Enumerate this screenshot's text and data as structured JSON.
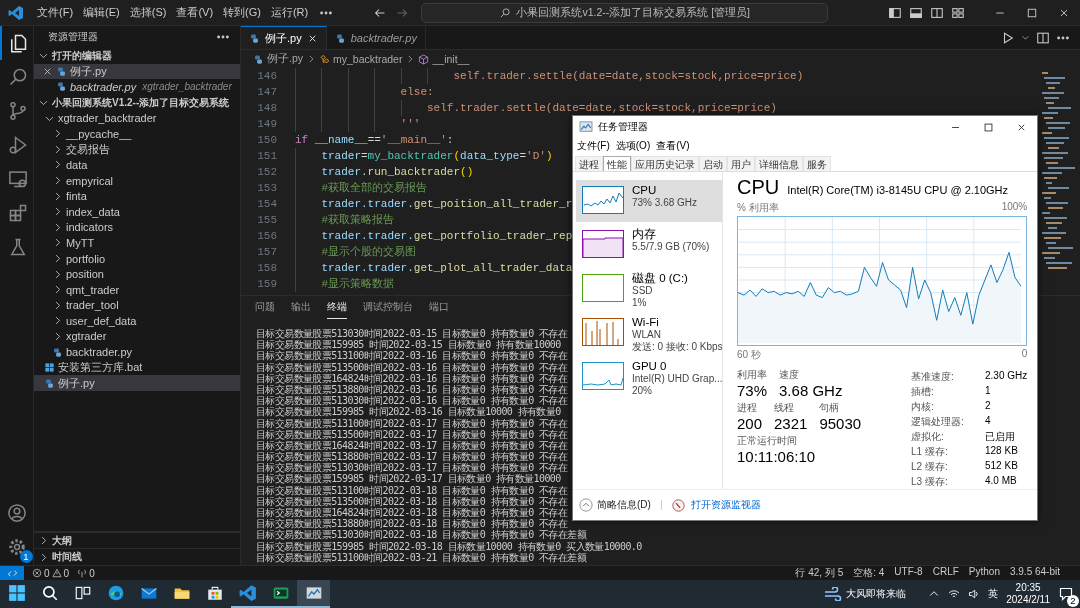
{
  "title_bar": {
    "menus": [
      "文件(F)",
      "编辑(E)",
      "选择(S)",
      "查看(V)",
      "转到(G)",
      "运行(R)"
    ],
    "command_center": "小果回测系统v1.2--添加了目标交易系统 [管理员]"
  },
  "activity_bar": {
    "items": [
      {
        "kind": "explorer",
        "selected": true
      },
      {
        "kind": "search",
        "selected": false
      },
      {
        "kind": "source-control",
        "selected": false
      },
      {
        "kind": "run",
        "selected": false
      },
      {
        "kind": "remote",
        "selected": false
      },
      {
        "kind": "extensions",
        "selected": false
      },
      {
        "kind": "testing",
        "selected": false
      }
    ],
    "settings_badge": "1"
  },
  "sidebar": {
    "title": "资源管理器",
    "open_editors": {
      "label": "打开的编辑器",
      "expanded": true,
      "items": [
        {
          "name": "例子.py",
          "selected": true,
          "italic": false
        },
        {
          "name": "backtrader.py",
          "detail": "xgtrader_backtrader",
          "selected": false,
          "italic": true
        }
      ]
    },
    "project": {
      "label": "小果回测系统V1.2--添加了目标交易系统",
      "expanded": true,
      "tree": [
        {
          "name": "xgtrader_backtrader",
          "kind": "folder",
          "expanded": true,
          "selected": false,
          "children": [
            {
              "name": "__pycache__",
              "kind": "folder",
              "expanded": false,
              "selected": false
            },
            {
              "name": "交易报告",
              "kind": "folder",
              "expanded": false,
              "selected": false
            },
            {
              "name": "data",
              "kind": "folder",
              "expanded": false,
              "selected": false
            },
            {
              "name": "empyrical",
              "kind": "folder",
              "expanded": false,
              "selected": false
            },
            {
              "name": "finta",
              "kind": "folder",
              "expanded": false,
              "selected": false
            },
            {
              "name": "index_data",
              "kind": "folder",
              "expanded": false,
              "selected": false
            },
            {
              "name": "indicators",
              "kind": "folder",
              "expanded": false,
              "selected": false
            },
            {
              "name": "MyTT",
              "kind": "folder",
              "expanded": false,
              "selected": false
            },
            {
              "name": "portfolio",
              "kind": "folder",
              "expanded": false,
              "selected": false
            },
            {
              "name": "position",
              "kind": "folder",
              "expanded": false,
              "selected": false
            },
            {
              "name": "qmt_trader",
              "kind": "folder",
              "expanded": false,
              "selected": false
            },
            {
              "name": "trader_tool",
              "kind": "folder",
              "expanded": false,
              "selected": false
            },
            {
              "name": "user_def_data",
              "kind": "folder",
              "expanded": false,
              "selected": false
            },
            {
              "name": "xgtrader",
              "kind": "folder",
              "expanded": false,
              "selected": false
            },
            {
              "name": "backtrader.py",
              "kind": "py",
              "selected": false
            }
          ]
        },
        {
          "name": "安装第三方库.bat",
          "kind": "bat",
          "selected": false
        },
        {
          "name": "例子.py",
          "kind": "py",
          "selected": true
        }
      ]
    },
    "bottom_sections": [
      {
        "label": "大纲",
        "expanded": false
      },
      {
        "label": "时间线",
        "expanded": false
      }
    ]
  },
  "editor": {
    "tabs": [
      {
        "label": "例子.py",
        "selected": true,
        "italic": false
      },
      {
        "label": "backtrader.py",
        "selected": false,
        "italic": true
      }
    ],
    "breadcrumb": [
      {
        "label": "例子.py",
        "kind": "file"
      },
      {
        "label": "my_backtrader",
        "kind": "class"
      },
      {
        "label": "__init__",
        "kind": "method"
      }
    ],
    "lines": [
      {
        "number": "146",
        "tokens": [
          {
            "text": "                        self.trader.settle(date=date,stock=stock,price=price)",
            "kind": "str"
          }
        ]
      },
      {
        "number": "147",
        "tokens": [
          {
            "text": "                else:",
            "kind": "str"
          }
        ]
      },
      {
        "number": "148",
        "tokens": [
          {
            "text": "                    self.trader.settle(date=date,stock=stock,price=price)",
            "kind": "str"
          }
        ]
      },
      {
        "number": "149",
        "tokens": [
          {
            "text": "                '''",
            "kind": "str"
          }
        ]
      },
      {
        "number": "150",
        "tokens": [
          {
            "text": "if",
            "kind": "kw"
          },
          {
            "text": " __name__",
            "kind": "var"
          },
          {
            "text": "==",
            "kind": "op"
          },
          {
            "text": "'__main__'",
            "kind": "str"
          },
          {
            "text": ":",
            "kind": "op"
          }
        ]
      },
      {
        "number": "151",
        "tokens": [
          {
            "text": "    trader",
            "kind": "var"
          },
          {
            "text": "=",
            "kind": "op"
          },
          {
            "text": "my_backtrader",
            "kind": "cls"
          },
          {
            "text": "(",
            "kind": "br"
          },
          {
            "text": "data_type",
            "kind": "var"
          },
          {
            "text": "=",
            "kind": "op"
          },
          {
            "text": "'D'",
            "kind": "str"
          },
          {
            "text": ")",
            "kind": "br"
          }
        ]
      },
      {
        "number": "152",
        "tokens": [
          {
            "text": "    trader",
            "kind": "var"
          },
          {
            "text": ".",
            "kind": "op"
          },
          {
            "text": "run_backtrader",
            "kind": "fn"
          },
          {
            "text": "()",
            "kind": "br"
          }
        ]
      },
      {
        "number": "153",
        "tokens": [
          {
            "text": "    #获取全部的交易报告",
            "kind": "cm"
          }
        ]
      },
      {
        "number": "154",
        "tokens": [
          {
            "text": "    trader.trader.",
            "kind": "var"
          },
          {
            "text": "get_poition_all_trader_r",
            "kind": "fn"
          }
        ]
      },
      {
        "number": "155",
        "tokens": [
          {
            "text": "    #获取策略报告",
            "kind": "cm"
          }
        ]
      },
      {
        "number": "156",
        "tokens": [
          {
            "text": "    trader.trader.",
            "kind": "var"
          },
          {
            "text": "get_portfolio_trader_rep",
            "kind": "fn"
          }
        ]
      },
      {
        "number": "157",
        "tokens": [
          {
            "text": "    #显示个股的交易图",
            "kind": "cm"
          }
        ]
      },
      {
        "number": "158",
        "tokens": [
          {
            "text": "    trader.trader.",
            "kind": "var"
          },
          {
            "text": "get_plot_all_trader_data",
            "kind": "fn"
          }
        ]
      },
      {
        "number": "159",
        "tokens": [
          {
            "text": "    #显示策略数据",
            "kind": "cm"
          }
        ]
      }
    ]
  },
  "panel": {
    "tabs": [
      {
        "label": "问题",
        "selected": false
      },
      {
        "label": "输出",
        "selected": false
      },
      {
        "label": "终端",
        "selected": true
      },
      {
        "label": "调试控制台",
        "selected": false
      },
      {
        "label": "端口",
        "selected": false
      }
    ],
    "lines": [
      "目标交易数量股票513030时间2022-03-15 目标数量0 持有数量0 不存在",
      "目标交易数量股票159985 时间2022-03-15 目标数量0 持有数量10000",
      "目标交易数量股票513100时间2022-03-16 目标数量0 持有数量0 不存在",
      "目标交易数量股票513500时间2022-03-16 目标数量0 持有数量0 不存在",
      "目标交易数量股票164824时间2022-03-16 目标数量0 持有数量0 不存在",
      "目标交易数量股票513880时间2022-03-16 目标数量0 持有数量0 不存在",
      "目标交易数量股票513030时间2022-03-16 目标数量0 持有数量0 不存在",
      "目标交易数量股票159985 时间2022-03-16 目标数量10000 持有数量0",
      "目标交易数量股票513100时间2022-03-17 目标数量0 持有数量0 不存在",
      "目标交易数量股票513500时间2022-03-17 目标数量0 持有数量0 不存在",
      "目标交易数量股票164824时间2022-03-17 目标数量0 持有数量0 不存在",
      "目标交易数量股票513880时间2022-03-17 目标数量0 持有数量0 不存在",
      "目标交易数量股票513030时间2022-03-17 目标数量0 持有数量0 不存在",
      "目标交易数量股票159985 时间2022-03-17 目标数量0 持有数量10000",
      "目标交易数量股票513100时间2022-03-18 目标数量0 持有数量0 不存在",
      "目标交易数量股票513500时间2022-03-18 目标数量0 持有数量0 不存在",
      "目标交易数量股票164824时间2022-03-18 目标数量0 持有数量0 不存在",
      "目标交易数量股票513880时间2022-03-18 目标数量0 持有数量0 不存在",
      "目标交易数量股票513030时间2022-03-18 目标数量0 持有数量0 不存在差额",
      "目标交易数量股票159985 时间2022-03-18 目标数量10000 持有数量0 买入数量10000.0",
      "目标交易数量股票513100时间2022-03-21 目标数量0 持有数量0 不存在差额"
    ]
  },
  "status_bar": {
    "errors": "0",
    "warnings": "0",
    "ports": "0",
    "right": [
      "行 42, 列 5",
      "空格: 4",
      "UTF-8",
      "CRLF",
      "Python",
      "3.9.5 64-bit"
    ]
  },
  "task_manager": {
    "title": "任务管理器",
    "menus": [
      "文件(F)",
      "选项(O)",
      "查看(V)"
    ],
    "tabs": [
      {
        "label": "进程",
        "selected": false
      },
      {
        "label": "性能",
        "selected": true
      },
      {
        "label": "应用历史记录",
        "selected": false
      },
      {
        "label": "启动",
        "selected": false
      },
      {
        "label": "用户",
        "selected": false
      },
      {
        "label": "详细信息",
        "selected": false
      },
      {
        "label": "服务",
        "selected": false
      }
    ],
    "resources": [
      {
        "kind": "cpu",
        "name": "CPU",
        "lines": [
          "73% 3.68 GHz"
        ],
        "selected": true,
        "color": "#117dbb"
      },
      {
        "kind": "memory",
        "name": "内存",
        "lines": [
          "5.5/7.9 GB (70%)"
        ],
        "selected": false,
        "color": "#8b12ae"
      },
      {
        "kind": "disk",
        "name": "磁盘 0 (C:)",
        "lines": [
          "SSD",
          "1%"
        ],
        "selected": false,
        "color": "#4da60c"
      },
      {
        "kind": "network",
        "name": "Wi-Fi",
        "lines": [
          "WLAN",
          "发送: 0 接收: 0 Kbps"
        ],
        "selected": false,
        "color": "#a74f01"
      },
      {
        "kind": "gpu",
        "name": "GPU 0",
        "lines": [
          "Intel(R) UHD Grap...",
          "20%"
        ],
        "selected": false,
        "color": "#1e90c8"
      }
    ],
    "detail": {
      "title": "CPU",
      "model": "Intel(R) Core(TM) i3-8145U CPU @ 2.10GHz",
      "graph_label": "% 利用率",
      "graph_max": "100%",
      "time_start": "60 秒",
      "time_end": "0",
      "stats": [
        {
          "label": "利用率",
          "value": "73%"
        },
        {
          "label": "速度",
          "value": "3.68 GHz"
        }
      ],
      "stats2": [
        {
          "label": "进程",
          "value": "200"
        },
        {
          "label": "线程",
          "value": "2321"
        },
        {
          "label": "句柄",
          "value": "95030"
        }
      ],
      "uptime": {
        "label": "正常运行时间",
        "value": "10:11:06:10"
      },
      "specs": [
        {
          "label": "基准速度:",
          "value": "2.30 GHz"
        },
        {
          "label": "插槽:",
          "value": "1"
        },
        {
          "label": "内核:",
          "value": "2"
        },
        {
          "label": "逻辑处理器:",
          "value": "4"
        },
        {
          "label": "虚拟化:",
          "value": "已启用"
        },
        {
          "label": "L1 缓存:",
          "value": "128 KB"
        },
        {
          "label": "L2 缓存:",
          "value": "512 KB"
        },
        {
          "label": "L3 缓存:",
          "value": "4.0 MB"
        }
      ]
    },
    "footer": {
      "summary": "简略信息(D)",
      "monitor_link": "打开资源监视器"
    }
  },
  "taskbar": {
    "apps": [
      {
        "kind": "browser",
        "running": false,
        "selected": false
      },
      {
        "kind": "mail",
        "running": false,
        "selected": false
      },
      {
        "kind": "folder",
        "running": false,
        "selected": false
      },
      {
        "kind": "store",
        "running": false,
        "selected": false
      },
      {
        "kind": "code",
        "running": true,
        "selected": false
      },
      {
        "kind": "terminal",
        "running": true,
        "selected": false
      },
      {
        "kind": "taskmgr",
        "running": true,
        "selected": true
      }
    ],
    "weather": "大风即将来临",
    "ime": "英",
    "time": "20:35",
    "date": "2024/2/11",
    "notifications": "2"
  }
}
